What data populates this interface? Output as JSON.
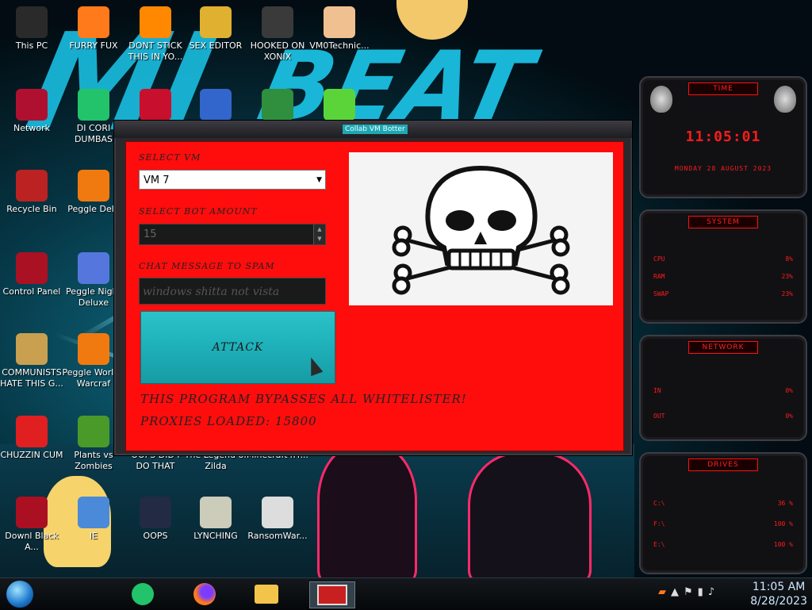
{
  "desktop_icons": [
    {
      "label": "This PC",
      "icon": "computer-icon",
      "color": "#2a2a2a"
    },
    {
      "label": "FURRY FUX",
      "icon": "firefox-icon",
      "color": "#ff7a1a"
    },
    {
      "label": "DONT STICK THIS IN YO...",
      "icon": "vlc-cone-icon",
      "color": "#ff8800"
    },
    {
      "label": "SEX EDITOR",
      "icon": "hxd-icon",
      "color": "#e0b030"
    },
    {
      "label": "HOOKED ON XONIX",
      "icon": "xonix-icon",
      "color": "#3a3a3a"
    },
    {
      "label": "VM0Technic...",
      "icon": "doctor-icon",
      "color": "#f0c090"
    },
    {
      "label": "Network",
      "icon": "network-icon",
      "color": "#b01030"
    },
    {
      "label": "DI CORI DUMBAS",
      "icon": "app-icon",
      "color": "#22c36a"
    },
    {
      "label": "",
      "icon": "devcpp-icon",
      "color": "#c8102e"
    },
    {
      "label": "",
      "icon": "card-icon",
      "color": "#3366cc"
    },
    {
      "label": "",
      "icon": "santa-icon",
      "color": "#2f8f3f"
    },
    {
      "label": "",
      "icon": "lime-icon",
      "color": "#5bd43a"
    },
    {
      "label": "Recycle Bin",
      "icon": "recycle-bin-icon",
      "color": "#bb2222"
    },
    {
      "label": "Peggle Delu",
      "icon": "peggle-icon",
      "color": "#f07a10"
    },
    {
      "label": "Control Panel",
      "icon": "control-panel-icon",
      "color": "#aa1122"
    },
    {
      "label": "Peggle Night Deluxe",
      "icon": "peggle-night-icon",
      "color": "#5577dd"
    },
    {
      "label": "COMMUNISTS HATE THIS G...",
      "icon": "money-bag-icon",
      "color": "#c8a050"
    },
    {
      "label": "Peggle Worl of Warcraf",
      "icon": "peggle-wow-icon",
      "color": "#f07a10"
    },
    {
      "label": "CHUZZIN CUM",
      "icon": "chuzzle-icon",
      "color": "#e02020"
    },
    {
      "label": "Plants vs Zombies",
      "icon": "pvz-icon",
      "color": "#4a9a2a"
    },
    {
      "label": "OOPS DID I DO THAT",
      "icon": "oops-icon",
      "color": "#eeeeee"
    },
    {
      "label": "The Legend of Zilda",
      "icon": "zelda-icon",
      "color": "#777777"
    },
    {
      "label": "Minecraft4Fr...",
      "icon": "minecraft-icon",
      "color": "#555555"
    },
    {
      "label": "Downl Black A...",
      "icon": "alien-ware-icon",
      "color": "#aa1022"
    },
    {
      "label": "IE",
      "icon": "ie-icon",
      "color": "#4a8ad8"
    },
    {
      "label": "OOPS",
      "icon": "monitor-icon",
      "color": "#222a44"
    },
    {
      "label": "LYNCHING",
      "icon": "noose-icon",
      "color": "#ccccbb"
    },
    {
      "label": "RansomWar...",
      "icon": "skull-icon",
      "color": "#dddddd"
    }
  ],
  "window": {
    "title": "Collab VM Botter",
    "select_vm_label": "SELECT VM",
    "select_vm_value": "VM 7",
    "bot_amount_label": "SELECT BOT AMOUNT",
    "bot_amount_value": "15",
    "chat_label": "CHAT MESSAGE TO SPAM",
    "chat_value": "windows shitta not vista",
    "attack_label": "ATTACK",
    "bypass_text": "THIS PROGRAM BYPASSES ALL WHITELISTER!",
    "proxies_text": "PROXIES LOADED: 15800",
    "accent": "#ff0d0d",
    "button_color": "#1fb2bb"
  },
  "hud": {
    "time_title": "TIME",
    "time_value": "11:05:01",
    "date_value": "MONDAY 28 AUGUST 2023",
    "system_title": "SYSTEM",
    "system_rows": [
      {
        "name": "CPU",
        "value": "8%"
      },
      {
        "name": "RAM",
        "value": "23%"
      },
      {
        "name": "SWAP",
        "value": "23%"
      }
    ],
    "network_title": "NETWORK",
    "network_rows": [
      {
        "name": "IN",
        "value": "0%"
      },
      {
        "name": "OUT",
        "value": "0%"
      }
    ],
    "drives_title": "DRIVES",
    "drive_rows": [
      {
        "name": "C:\\",
        "value": "36 %"
      },
      {
        "name": "F:\\",
        "value": "100 %"
      },
      {
        "name": "E:\\",
        "value": "100 %"
      }
    ]
  },
  "taskbar": {
    "time": "11:05 AM",
    "date": "8/28/2023",
    "apps": [
      "chat-app-icon",
      "firefox-icon",
      "file-explorer-icon",
      "vm-botter-icon"
    ]
  }
}
